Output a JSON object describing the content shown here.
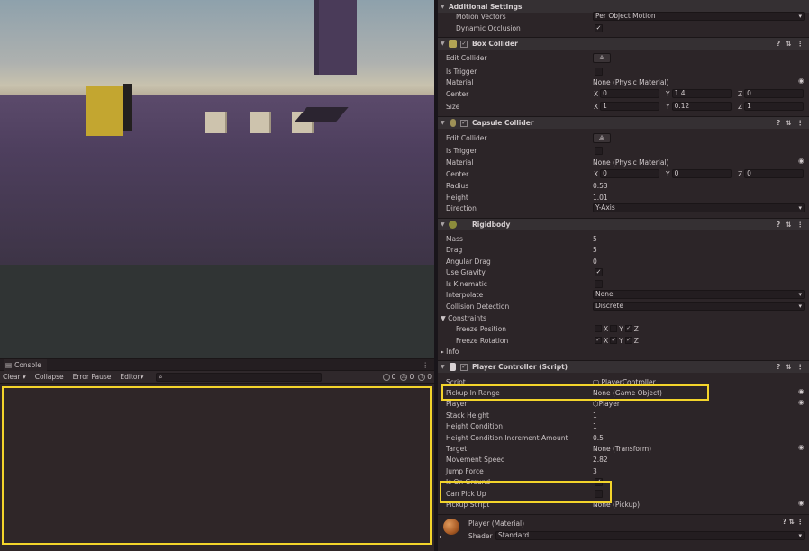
{
  "console": {
    "tab_label": "Console",
    "toolbar": {
      "clear": "Clear",
      "collapse": "Collapse",
      "error_pause": "Error Pause",
      "editor": "Editor"
    },
    "search_placeholder": "",
    "counts": {
      "info": "0",
      "warnings": "0",
      "errors": "0"
    }
  },
  "inspector": {
    "additional_settings": {
      "title": "Additional Settings",
      "motion_vectors_label": "Motion Vectors",
      "motion_vectors_value": "Per Object Motion",
      "dynamic_occlusion_label": "Dynamic Occlusion"
    },
    "box_collider": {
      "title": "Box Collider",
      "edit_collider": "Edit Collider",
      "is_trigger": "Is Trigger",
      "material_label": "Material",
      "material_value": "None (Physic Material)",
      "center_label": "Center",
      "center": {
        "x": "0",
        "y": "1.4",
        "z": "0"
      },
      "size_label": "Size",
      "size": {
        "x": "1",
        "y": "0.12",
        "z": "1"
      }
    },
    "capsule_collider": {
      "title": "Capsule Collider",
      "edit_collider": "Edit Collider",
      "is_trigger": "Is Trigger",
      "material_label": "Material",
      "material_value": "None (Physic Material)",
      "center_label": "Center",
      "center": {
        "x": "0",
        "y": "0",
        "z": "0"
      },
      "radius_label": "Radius",
      "radius_value": "0.53",
      "height_label": "Height",
      "height_value": "1.01",
      "direction_label": "Direction",
      "direction_value": "Y-Axis"
    },
    "rigidbody": {
      "title": "Rigidbody",
      "mass_label": "Mass",
      "mass_value": "5",
      "drag_label": "Drag",
      "drag_value": "5",
      "angular_drag_label": "Angular Drag",
      "angular_drag_value": "0",
      "use_gravity_label": "Use Gravity",
      "is_kinematic_label": "Is Kinematic",
      "interpolate_label": "Interpolate",
      "interpolate_value": "None",
      "collision_detection_label": "Collision Detection",
      "collision_detection_value": "Discrete",
      "constraints_label": "Constraints",
      "freeze_position_label": "Freeze Position",
      "freeze_rotation_label": "Freeze Rotation",
      "axes": {
        "x": "X",
        "y": "Y",
        "z": "Z"
      },
      "info_label": "Info"
    },
    "player_controller": {
      "title": "Player Controller (Script)",
      "script_label": "Script",
      "script_value": "PlayerController",
      "pickup_in_range_label": "Pickup In Range",
      "pickup_in_range_value": "None (Game Object)",
      "player_label": "Player",
      "player_value": "Player",
      "stack_height_label": "Stack Height",
      "stack_height_value": "1",
      "height_condition_label": "Height Condition",
      "height_condition_value": "1",
      "height_condition_increment_label": "Height Condition Increment Amount",
      "height_condition_increment_value": "0.5",
      "target_label": "Target",
      "target_value": "None (Transform)",
      "movement_speed_label": "Movement Speed",
      "movement_speed_value": "2.82",
      "jump_force_label": "Jump Force",
      "jump_force_value": "3",
      "is_on_ground_label": "Is On Ground",
      "can_pick_up_label": "Can Pick Up",
      "pickup_script_label": "Pickup Script",
      "pickup_script_value": "None (Pickup)"
    },
    "material": {
      "title": "Player (Material)",
      "shader_label": "Shader",
      "shader_value": "Standard"
    }
  },
  "colors": {
    "highlight": "#f3d42b",
    "floor": "#4e3f5e",
    "accent_cube": "#c3a630"
  }
}
